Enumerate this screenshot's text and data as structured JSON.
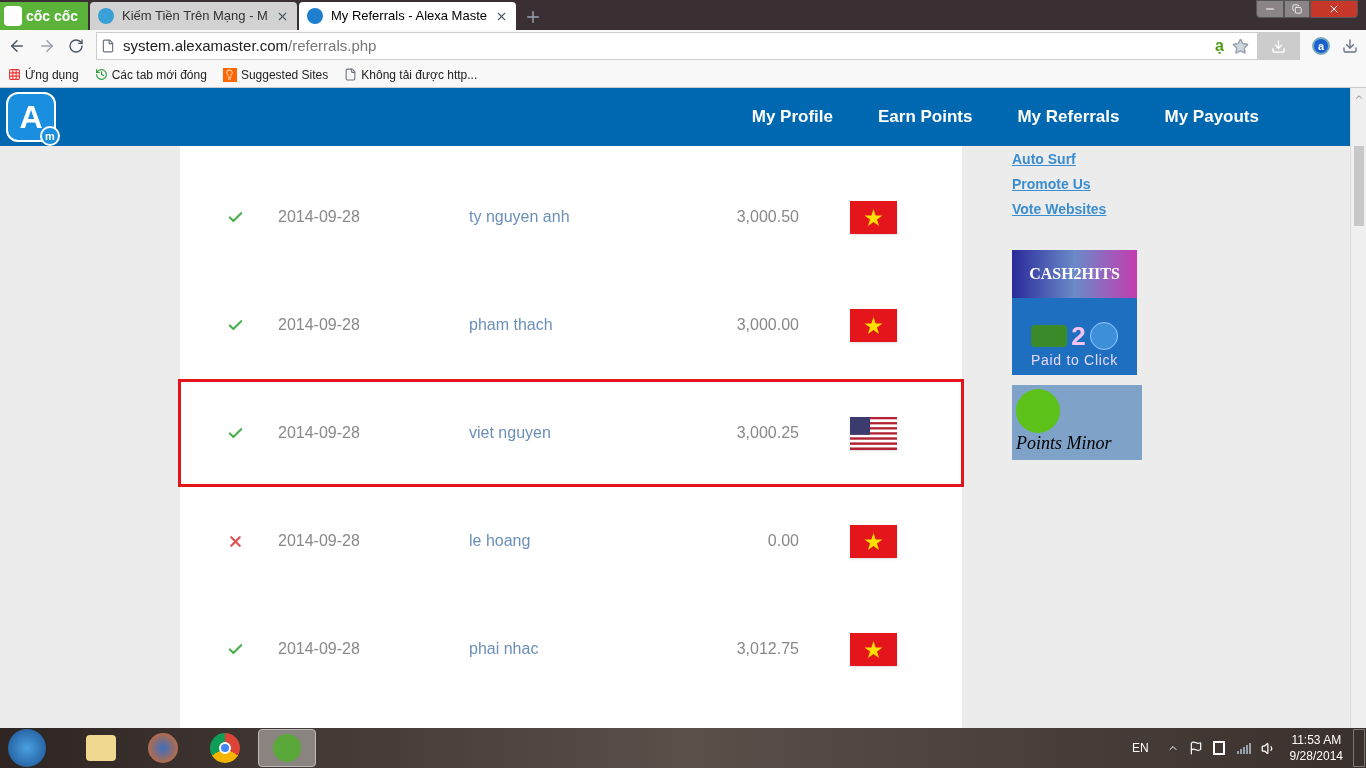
{
  "browser": {
    "brand": "cốc cốc",
    "tabs": [
      {
        "title": "Kiếm Tiền Trên Mạng - M",
        "selected": false
      },
      {
        "title": "My Referrals - Alexa Maste",
        "selected": true
      }
    ],
    "url_host": "system.alexamaster.com",
    "url_path": "/referrals.php",
    "addon_glyphs": [
      "ạ",
      "a"
    ],
    "bookmarks": [
      {
        "label": "Ứng dụng",
        "kind": "apps"
      },
      {
        "label": "Các tab mới đóng",
        "kind": "history"
      },
      {
        "label": "Suggested Sites",
        "kind": "bulb"
      },
      {
        "label": "Không tải được http...",
        "kind": "page"
      }
    ]
  },
  "site": {
    "logo": "A",
    "logo_sub": "m",
    "nav": [
      "My Profile",
      "Earn Points",
      "My Referrals",
      "My Payouts"
    ]
  },
  "referrals": [
    {
      "active": true,
      "date": "2014-09-28",
      "name": "ty nguyen anh",
      "points": "3,000.50",
      "kind": "vn",
      "highlighted": false
    },
    {
      "active": true,
      "date": "2014-09-28",
      "name": "pham thach",
      "points": "3,000.00",
      "kind": "vn",
      "highlighted": false
    },
    {
      "active": true,
      "date": "2014-09-28",
      "name": "viet nguyen",
      "points": "3,000.25",
      "kind": "us",
      "highlighted": true
    },
    {
      "active": false,
      "date": "2014-09-28",
      "name": "le hoang",
      "points": "0.00",
      "kind": "vn",
      "highlighted": false
    },
    {
      "active": true,
      "date": "2014-09-28",
      "name": "phai nhac",
      "points": "3,012.75",
      "kind": "vn",
      "highlighted": false
    }
  ],
  "sidebar_links": [
    "Auto Surf",
    "Promote Us",
    "Vote Websites"
  ],
  "banners": [
    {
      "title": "CASH2HITS",
      "number": "2",
      "caption": "Paid to Click"
    },
    {
      "caption": "Points Minor"
    }
  ],
  "taskbar": {
    "language": "EN",
    "time": "11:53 AM",
    "date": "9/28/2014"
  }
}
